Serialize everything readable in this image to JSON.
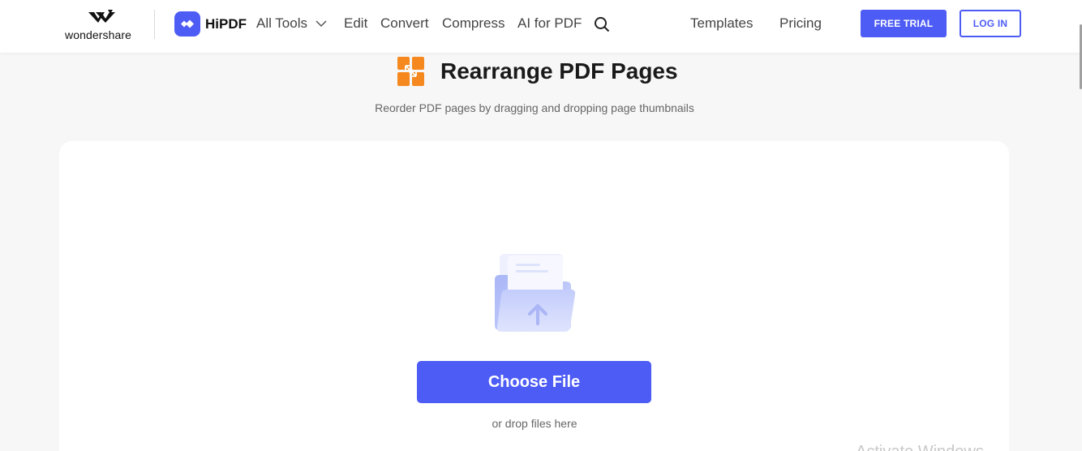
{
  "header": {
    "brand": "wondershare",
    "product": "HiPDF",
    "nav": {
      "all_tools": "All Tools",
      "edit": "Edit",
      "convert": "Convert",
      "compress": "Compress",
      "ai_for_pdf": "AI for PDF",
      "templates": "Templates",
      "pricing": "Pricing"
    },
    "free_trial": "FREE TRIAL",
    "login": "LOG IN"
  },
  "tool": {
    "title": "Rearrange PDF Pages",
    "subtitle": "Reorder PDF pages by dragging and dropping page thumbnails",
    "icon": "rearrange-icon"
  },
  "upload": {
    "choose_label": "Choose File",
    "drop_hint": "or drop files here",
    "icon": "folder-upload-icon"
  },
  "overlay": {
    "watermark": "Activate Windows"
  },
  "colors": {
    "accent": "#4d5cf5",
    "tool_orange": "#f5891f"
  }
}
